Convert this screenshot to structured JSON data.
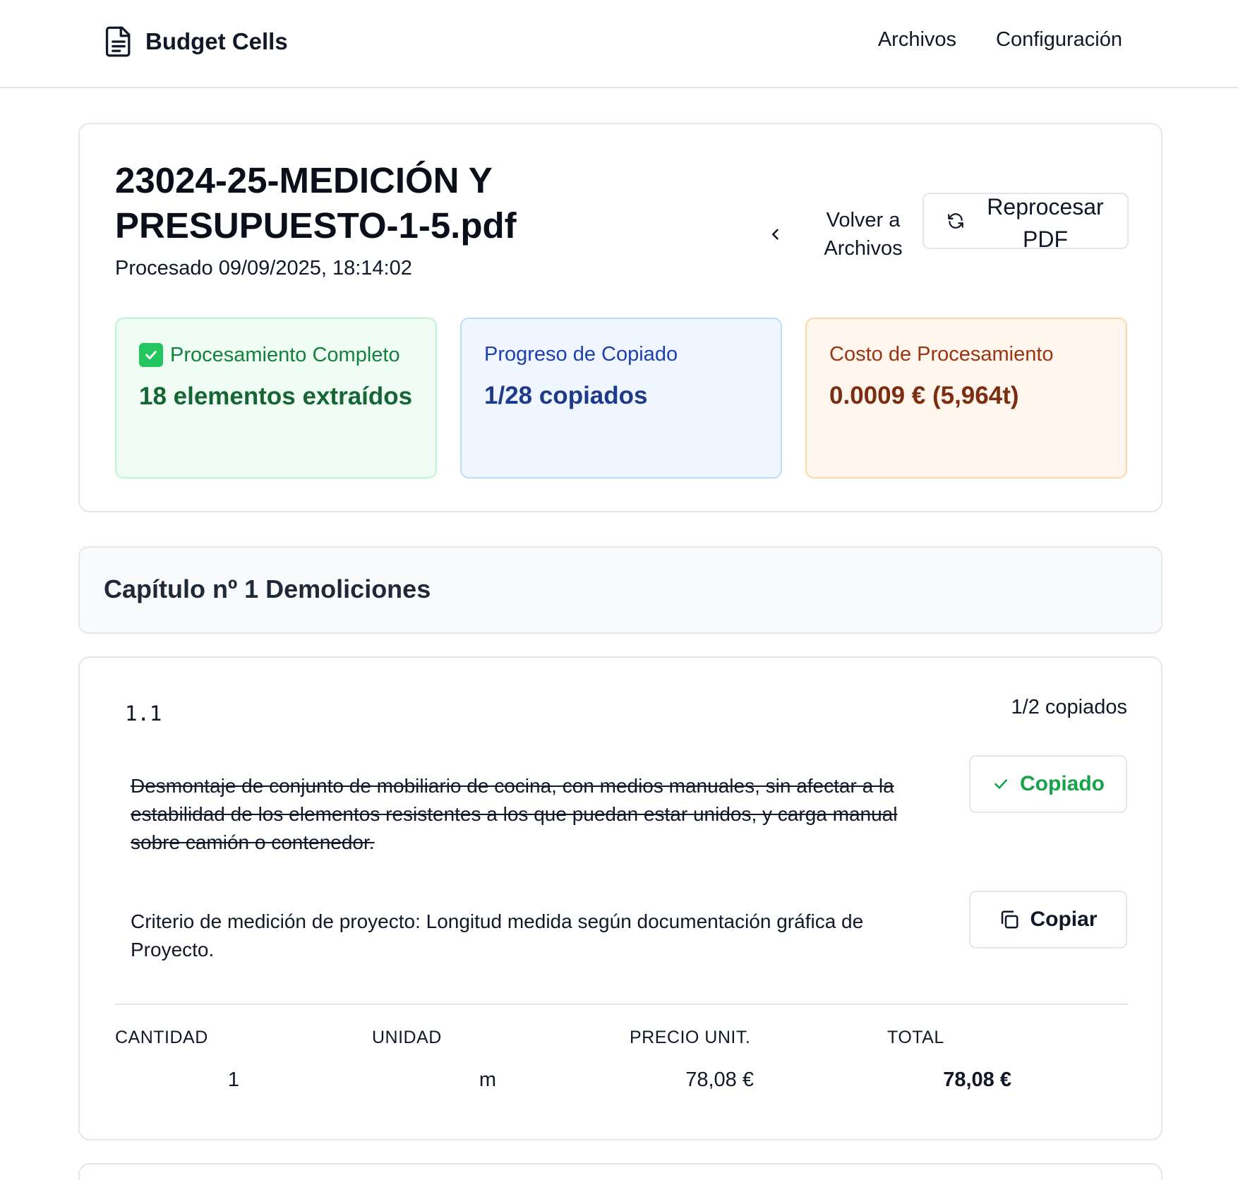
{
  "header": {
    "brand_name": "Budget Cells",
    "nav": [
      "Archivos",
      "Configuración"
    ]
  },
  "summary": {
    "title": "23024-25-MEDICIÓN Y PRESUPUESTO-1-5.pdf",
    "processed": "Procesado 09/09/2025, 18:14:02",
    "back_button": "Volver a Archivos",
    "reprocess_button": "Reprocesar PDF",
    "stats": [
      {
        "label": "Procesamiento Completo",
        "value": "18 elementos extraídos",
        "color": "#15803d"
      },
      {
        "label": "Progreso de Copiado",
        "value": "1/28 copiados",
        "color": "#1e40af"
      },
      {
        "label": "Costo de Procesamiento",
        "value": "0.0009 € (5,964t)",
        "color": "#9a3412"
      }
    ]
  },
  "chapter": {
    "title": "Capítulo nº 1 Demoliciones"
  },
  "item": {
    "code": "1.1",
    "progress": "1/2 copiados",
    "rows": [
      {
        "text": "Desmontaje de conjunto de mobiliario de cocina, con medios manuales, sin afectar a la estabilidad de los elementos resistentes a los que puedan estar unidos, y carga manual sobre camión o contenedor.",
        "copied": true,
        "button": "Copiado"
      },
      {
        "text": "Criterio de medición de proyecto: Longitud medida según documentación gráfica de Proyecto.",
        "copied": false,
        "button": "Copiar"
      }
    ],
    "table": {
      "headers": [
        "CANTIDAD",
        "UNIDAD",
        "PRECIO UNIT.",
        "TOTAL"
      ],
      "values": [
        "1",
        "m",
        "78,08 €",
        "78,08 €"
      ]
    }
  }
}
